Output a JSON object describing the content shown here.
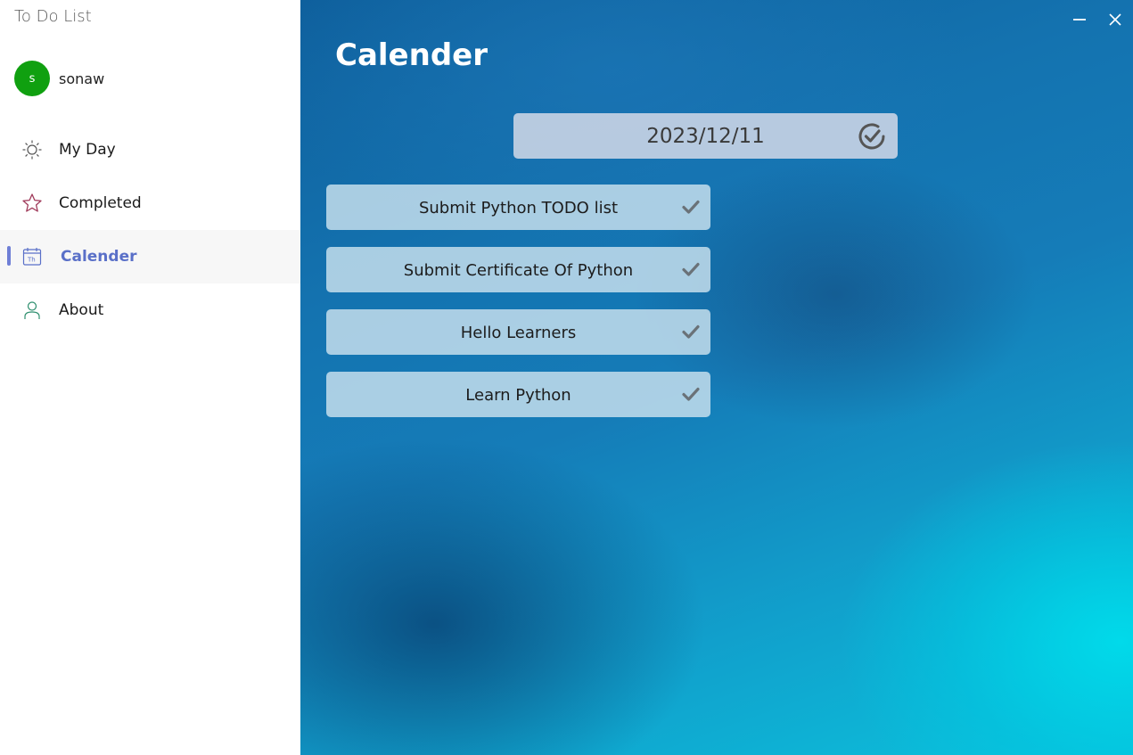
{
  "app": {
    "title": "To Do List"
  },
  "user": {
    "initial": "s",
    "name": "sonaw",
    "avatar_color": "#10a010"
  },
  "sidebar": {
    "items": [
      {
        "label": "My Day",
        "icon": "sun-icon",
        "active": false
      },
      {
        "label": "Completed",
        "icon": "star-icon",
        "active": false
      },
      {
        "label": "Calender",
        "icon": "calendar-icon",
        "active": true
      },
      {
        "label": "About",
        "icon": "person-icon",
        "active": false
      }
    ],
    "accent_color": "#5a70c8"
  },
  "window_controls": {
    "minimize_icon": "minimize-icon",
    "close_icon": "close-icon"
  },
  "main": {
    "title": "Calender",
    "date": "2023/12/11",
    "date_confirm_icon": "check-circle-icon",
    "tasks": [
      {
        "label": "Submit Python TODO list",
        "icon": "check-icon"
      },
      {
        "label": "Submit Certificate Of Python",
        "icon": "check-icon"
      },
      {
        "label": "Hello Learners",
        "icon": "check-icon"
      },
      {
        "label": "Learn Python",
        "icon": "check-icon"
      }
    ]
  }
}
